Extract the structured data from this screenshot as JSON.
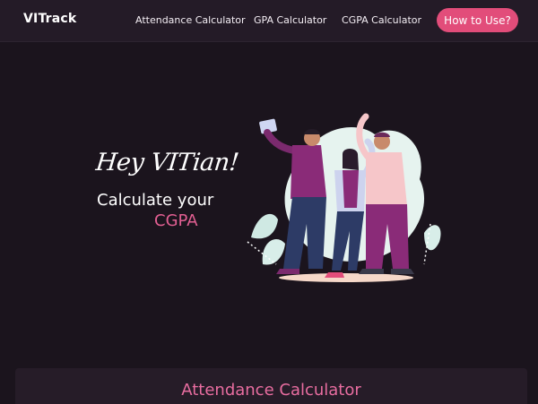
{
  "navbar": {
    "logo": "VITrack",
    "links": [
      {
        "label": "Attendance Calculator"
      },
      {
        "label": "GPA Calculator"
      },
      {
        "label": "CGPA Calculator"
      }
    ],
    "cta_label": "How to Use?"
  },
  "hero": {
    "greeting": "Hey VITian!",
    "line1": "Calculate your",
    "line2": "CGPA",
    "illustration": "friends-selfie-illustration"
  },
  "section": {
    "title": "Attendance Calculator"
  },
  "colors": {
    "background": "#1b141d",
    "navbar": "#241b27",
    "accent": "#e24d7a",
    "highlight": "#e25f92"
  }
}
